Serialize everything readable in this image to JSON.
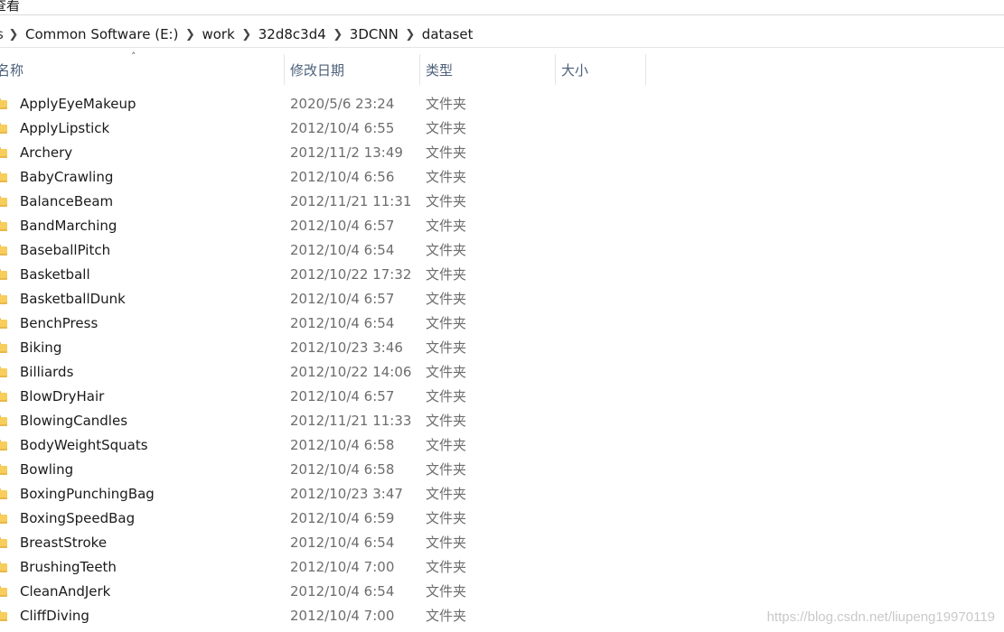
{
  "ribbon": {
    "tab_label": "查看"
  },
  "address": {
    "lead": "s",
    "crumbs": [
      "Common Software (E:)",
      "work",
      "32d8c3d4",
      "3DCNN",
      "dataset"
    ]
  },
  "columns": {
    "name": "名称",
    "modified": "修改日期",
    "type": "类型",
    "size": "大小",
    "sort_indicator": "^"
  },
  "files": [
    {
      "name": "ApplyEyeMakeup",
      "modified": "2020/5/6 23:24",
      "type": "文件夹"
    },
    {
      "name": "ApplyLipstick",
      "modified": "2012/10/4 6:55",
      "type": "文件夹"
    },
    {
      "name": "Archery",
      "modified": "2012/11/2 13:49",
      "type": "文件夹"
    },
    {
      "name": "BabyCrawling",
      "modified": "2012/10/4 6:56",
      "type": "文件夹"
    },
    {
      "name": "BalanceBeam",
      "modified": "2012/11/21 11:31",
      "type": "文件夹"
    },
    {
      "name": "BandMarching",
      "modified": "2012/10/4 6:57",
      "type": "文件夹"
    },
    {
      "name": "BaseballPitch",
      "modified": "2012/10/4 6:54",
      "type": "文件夹"
    },
    {
      "name": "Basketball",
      "modified": "2012/10/22 17:32",
      "type": "文件夹"
    },
    {
      "name": "BasketballDunk",
      "modified": "2012/10/4 6:57",
      "type": "文件夹"
    },
    {
      "name": "BenchPress",
      "modified": "2012/10/4 6:54",
      "type": "文件夹"
    },
    {
      "name": "Biking",
      "modified": "2012/10/23 3:46",
      "type": "文件夹"
    },
    {
      "name": "Billiards",
      "modified": "2012/10/22 14:06",
      "type": "文件夹"
    },
    {
      "name": "BlowDryHair",
      "modified": "2012/10/4 6:57",
      "type": "文件夹"
    },
    {
      "name": "BlowingCandles",
      "modified": "2012/11/21 11:33",
      "type": "文件夹"
    },
    {
      "name": "BodyWeightSquats",
      "modified": "2012/10/4 6:58",
      "type": "文件夹"
    },
    {
      "name": "Bowling",
      "modified": "2012/10/4 6:58",
      "type": "文件夹"
    },
    {
      "name": "BoxingPunchingBag",
      "modified": "2012/10/23 3:47",
      "type": "文件夹"
    },
    {
      "name": "BoxingSpeedBag",
      "modified": "2012/10/4 6:59",
      "type": "文件夹"
    },
    {
      "name": "BreastStroke",
      "modified": "2012/10/4 6:54",
      "type": "文件夹"
    },
    {
      "name": "BrushingTeeth",
      "modified": "2012/10/4 7:00",
      "type": "文件夹"
    },
    {
      "name": "CleanAndJerk",
      "modified": "2012/10/4 6:54",
      "type": "文件夹"
    },
    {
      "name": "CliffDiving",
      "modified": "2012/10/4 7:00",
      "type": "文件夹"
    }
  ],
  "icons": {
    "folder": "folder-icon",
    "separator": "chevron-right-icon"
  },
  "colors": {
    "folder": "#f7cd5b",
    "header_text": "#4c607a",
    "secondary_text": "#6d6d6d"
  },
  "watermark": "https://blog.csdn.net/liupeng19970119"
}
